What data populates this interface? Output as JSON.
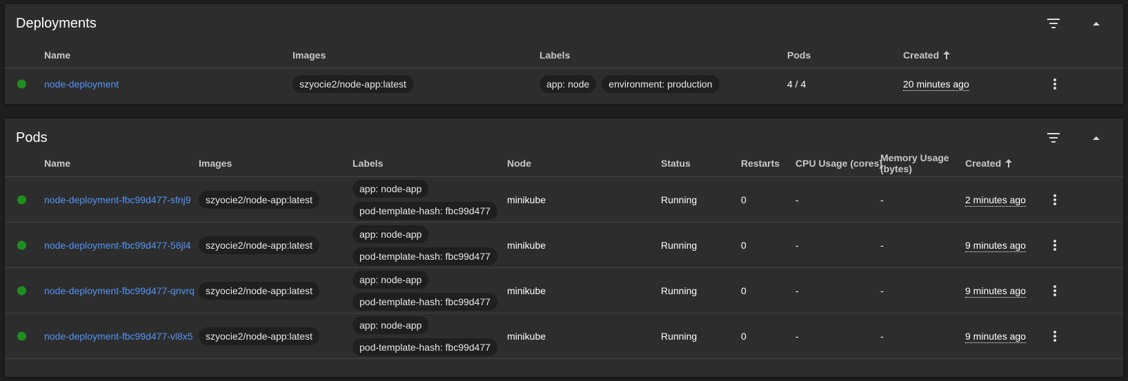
{
  "deployments": {
    "title": "Deployments",
    "columns": {
      "name": "Name",
      "images": "Images",
      "labels": "Labels",
      "pods": "Pods",
      "created": "Created"
    },
    "rows": [
      {
        "name": "node-deployment",
        "image": "szyocie2/node-app:latest",
        "labels": [
          "app: node",
          "environment: production"
        ],
        "pods": "4 / 4",
        "created": "20 minutes ago"
      }
    ]
  },
  "pods": {
    "title": "Pods",
    "columns": {
      "name": "Name",
      "images": "Images",
      "labels": "Labels",
      "node": "Node",
      "status": "Status",
      "restarts": "Restarts",
      "cpu": "CPU Usage (cores)",
      "memory_line1": "Memory Usage",
      "memory_line2": "(bytes)",
      "created": "Created"
    },
    "rows": [
      {
        "name": "node-deployment-fbc99d477-sfnj9",
        "image": "szyocie2/node-app:latest",
        "labels": [
          "app: node-app",
          "pod-template-hash: fbc99d477"
        ],
        "node": "minikube",
        "status": "Running",
        "restarts": "0",
        "cpu": "-",
        "memory": "-",
        "created": "2 minutes ago"
      },
      {
        "name": "node-deployment-fbc99d477-58jl4",
        "image": "szyocie2/node-app:latest",
        "labels": [
          "app: node-app",
          "pod-template-hash: fbc99d477"
        ],
        "node": "minikube",
        "status": "Running",
        "restarts": "0",
        "cpu": "-",
        "memory": "-",
        "created": "9 minutes ago"
      },
      {
        "name": "node-deployment-fbc99d477-qnvrq",
        "image": "szyocie2/node-app:latest",
        "labels": [
          "app: node-app",
          "pod-template-hash: fbc99d477"
        ],
        "node": "minikube",
        "status": "Running",
        "restarts": "0",
        "cpu": "-",
        "memory": "-",
        "created": "9 minutes ago"
      },
      {
        "name": "node-deployment-fbc99d477-vl8x5",
        "image": "szyocie2/node-app:latest",
        "labels": [
          "app: node-app",
          "pod-template-hash: fbc99d477"
        ],
        "node": "minikube",
        "status": "Running",
        "restarts": "0",
        "cpu": "-",
        "memory": "-",
        "created": "9 minutes ago"
      }
    ]
  },
  "colors": {
    "background": "#1e1e1e",
    "card": "#2d2d2d",
    "link": "#5394f5",
    "status_ok": "#1e8e1e",
    "chip": "#1f1f1f"
  }
}
